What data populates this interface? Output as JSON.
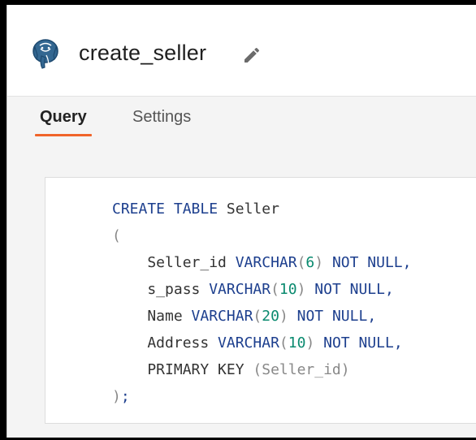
{
  "header": {
    "title": "create_seller",
    "db_icon": "postgresql-elephant-icon",
    "edit_icon": "pencil-icon"
  },
  "tabs": [
    {
      "label": "Query",
      "active": true
    },
    {
      "label": "Settings",
      "active": false
    }
  ],
  "editor": {
    "lines": [
      [
        {
          "t": "CREATE TABLE ",
          "c": "kw"
        },
        {
          "t": "Seller",
          "c": "ident"
        }
      ],
      [
        {
          "t": "(",
          "c": "punc"
        }
      ],
      [
        {
          "t": "    Seller_id ",
          "c": "ident"
        },
        {
          "t": "VARCHAR",
          "c": "kw"
        },
        {
          "t": "(",
          "c": "punc"
        },
        {
          "t": "6",
          "c": "num"
        },
        {
          "t": ")",
          "c": "punc"
        },
        {
          "t": " NOT NULL,",
          "c": "kw"
        }
      ],
      [
        {
          "t": "    s_pass ",
          "c": "ident"
        },
        {
          "t": "VARCHAR",
          "c": "kw"
        },
        {
          "t": "(",
          "c": "punc"
        },
        {
          "t": "10",
          "c": "num"
        },
        {
          "t": ")",
          "c": "punc"
        },
        {
          "t": " NOT NULL,",
          "c": "kw"
        }
      ],
      [
        {
          "t": "    Name ",
          "c": "ident"
        },
        {
          "t": "VARCHAR",
          "c": "kw"
        },
        {
          "t": "(",
          "c": "punc"
        },
        {
          "t": "20",
          "c": "num"
        },
        {
          "t": ")",
          "c": "punc"
        },
        {
          "t": " NOT NULL,",
          "c": "kw"
        }
      ],
      [
        {
          "t": "    Address ",
          "c": "ident"
        },
        {
          "t": "VARCHAR",
          "c": "kw"
        },
        {
          "t": "(",
          "c": "punc"
        },
        {
          "t": "10",
          "c": "num"
        },
        {
          "t": ")",
          "c": "punc"
        },
        {
          "t": " NOT NULL,",
          "c": "kw"
        }
      ],
      [
        {
          "t": "    PRIMARY KEY ",
          "c": "ident"
        },
        {
          "t": "(Seller_id)",
          "c": "punc"
        }
      ],
      [
        {
          "t": ")",
          "c": "punc"
        },
        {
          "t": ";",
          "c": "kw"
        }
      ]
    ]
  },
  "colors": {
    "accent": "#f0642a",
    "keyword": "#1d3f8e",
    "number": "#0a8a6f",
    "punctuation": "#888888"
  }
}
